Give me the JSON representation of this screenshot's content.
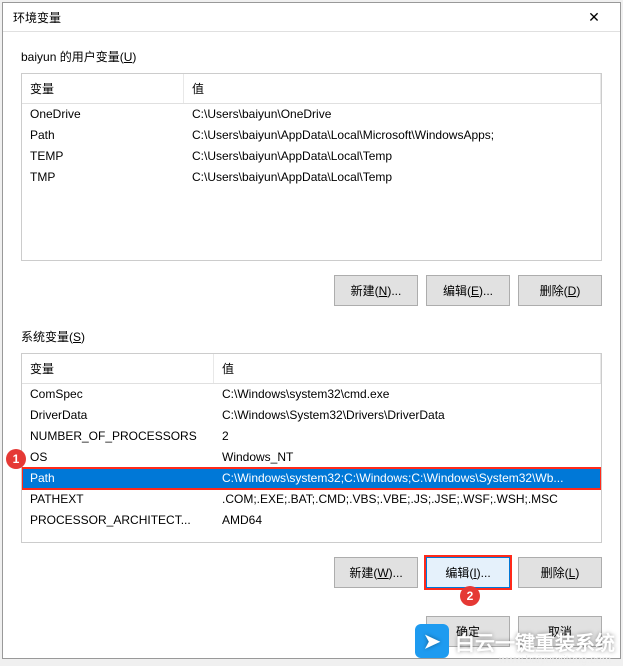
{
  "title": "环境变量",
  "user_section_label": "baiyun 的用户变量(",
  "user_section_mnemonic": "U",
  "user_section_suffix": ")",
  "headers": {
    "variable": "变量",
    "value": "值"
  },
  "user_vars": [
    {
      "name": "OneDrive",
      "value": "C:\\Users\\baiyun\\OneDrive"
    },
    {
      "name": "Path",
      "value": "C:\\Users\\baiyun\\AppData\\Local\\Microsoft\\WindowsApps;"
    },
    {
      "name": "TEMP",
      "value": "C:\\Users\\baiyun\\AppData\\Local\\Temp"
    },
    {
      "name": "TMP",
      "value": "C:\\Users\\baiyun\\AppData\\Local\\Temp"
    }
  ],
  "user_buttons": {
    "new": "新建(",
    "new_m": "N",
    "new_s": ")...",
    "edit": "编辑(",
    "edit_m": "E",
    "edit_s": ")...",
    "del": "删除(",
    "del_m": "D",
    "del_s": ")"
  },
  "sys_section_label": "系统变量(",
  "sys_section_mnemonic": "S",
  "sys_section_suffix": ")",
  "sys_vars": [
    {
      "name": "ComSpec",
      "value": "C:\\Windows\\system32\\cmd.exe"
    },
    {
      "name": "DriverData",
      "value": "C:\\Windows\\System32\\Drivers\\DriverData"
    },
    {
      "name": "NUMBER_OF_PROCESSORS",
      "value": "2"
    },
    {
      "name": "OS",
      "value": "Windows_NT"
    },
    {
      "name": "Path",
      "value": "C:\\Windows\\system32;C:\\Windows;C:\\Windows\\System32\\Wb..."
    },
    {
      "name": "PATHEXT",
      "value": ".COM;.EXE;.BAT;.CMD;.VBS;.VBE;.JS;.JSE;.WSF;.WSH;.MSC"
    },
    {
      "name": "PROCESSOR_ARCHITECT...",
      "value": "AMD64"
    }
  ],
  "sys_selected_index": 4,
  "sys_buttons": {
    "new": "新建(",
    "new_m": "W",
    "new_s": ")...",
    "edit": "编辑(",
    "edit_m": "I",
    "edit_s": ")...",
    "del": "删除(",
    "del_m": "L",
    "del_s": ")"
  },
  "footer": {
    "ok": "确定",
    "cancel": "取消"
  },
  "annotations": {
    "one": "1",
    "two": "2"
  },
  "watermark": {
    "text": "白云一键重装系统",
    "sub": "www.baiyunxitong.com"
  }
}
